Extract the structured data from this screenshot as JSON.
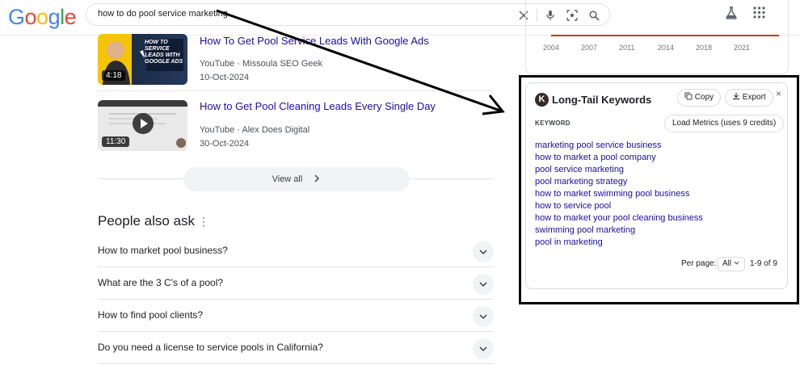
{
  "header": {
    "logo": [
      "G",
      "o",
      "o",
      "g",
      "l",
      "e"
    ],
    "logo_colors": [
      "#4285f4",
      "#ea4335",
      "#fbbc05",
      "#4285f4",
      "#34a853",
      "#ea4335"
    ],
    "query": "how to do pool service marketing"
  },
  "videos": [
    {
      "title": "How To Get Pool Service Leads With Google Ads",
      "source": "YouTube · Missoula SEO Geek",
      "date": "10-Oct-2024",
      "duration": "4:18",
      "thumb_text": "HOW TO SERVICE LEADS WITH GOOGLE ADS"
    },
    {
      "title": "How to Get Pool Cleaning Leads Every Single Day",
      "source": "YouTube · Alex Does Digital",
      "date": "30-Oct-2024",
      "duration": "11:30"
    }
  ],
  "view_all": "View all",
  "people_also_ask": {
    "title": "People also ask",
    "questions": [
      "How to market pool business?",
      "What are the 3 C's of a pool?",
      "How to find pool clients?",
      "Do you need a license to service pools in California?"
    ]
  },
  "chart": {
    "years": [
      "2004",
      "2007",
      "2011",
      "2014",
      "2018",
      "2021"
    ],
    "line_color": "#d93025"
  },
  "keywords_panel": {
    "logo_letter": "K",
    "title": "Long-Tail Keywords",
    "copy_label": "Copy",
    "export_label": "Export",
    "close": "×",
    "column_header": "KEYWORD",
    "load_metrics": "Load Metrics (uses 9 credits)",
    "keywords": [
      "marketing pool service business",
      "how to market a pool company",
      "pool service marketing",
      "pool marketing strategy",
      "how to market swimming pool business",
      "how to service pool",
      "how to market your pool cleaning business",
      "swimming pool marketing",
      "pool in marketing"
    ],
    "per_page_label": "Per page:",
    "per_page_value": "All",
    "range": "1-9 of 9"
  }
}
